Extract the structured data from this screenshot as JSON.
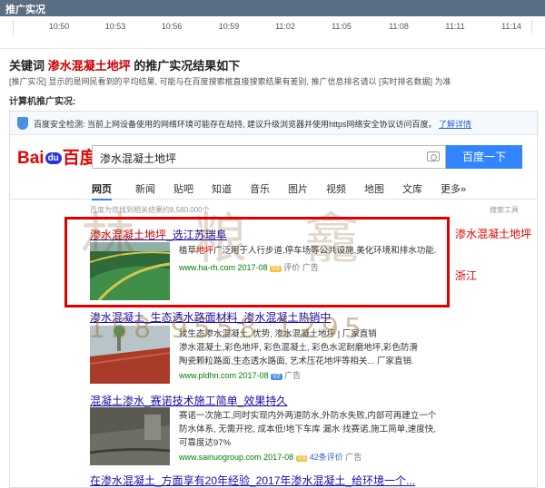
{
  "panel": {
    "title": "推广实况"
  },
  "timeline": {
    "ticks": [
      "10:50",
      "10:53",
      "10:56",
      "10:59",
      "11:02",
      "11:05",
      "11:08",
      "11:11",
      "11:14"
    ]
  },
  "headline": {
    "prefix": "关键词",
    "keyword": "渗水混凝土地坪",
    "suffix": "的推广实况结果如下"
  },
  "subnote": "[推广实况] 显示的是网民看到的平均结果, 可能与在百度搜索框直接搜索结果有差别, 推广信息排名请以 [实时排名数据] 为准",
  "section_title": "计算机推广实况:",
  "safety": {
    "text": "百度安全检测: 当前上网设备使用的网络环境可能存在劫持, 建议升级浏览器并使用https网络安全协议访问百度。",
    "link": "了解详情"
  },
  "search": {
    "logo_left": "Bai",
    "logo_mid": "du",
    "logo_right": "百度",
    "query": "渗水混凝土地坪",
    "button": "百度一下"
  },
  "tabs": [
    "网页",
    "新闻",
    "贴吧",
    "知道",
    "音乐",
    "图片",
    "视频",
    "地图",
    "文库",
    "更多»"
  ],
  "result_count": "百度为您找到相关结果约8,580,000个",
  "tools": "搜索工具",
  "results": [
    {
      "title_kw": "渗水混凝土地坪",
      "title_rest": "_选江苏瑞阜",
      "desc_pre": "植草",
      "desc_kw": "地坪",
      "desc_post": "广泛用于人行步道,停车场等公共设施,美化环境和排水功能.",
      "url": "www.ha-rh.com",
      "date": "2017-08",
      "badge": "V3",
      "eval": "评价",
      "ad": "广告"
    },
    {
      "title": "渗水混凝土_生态透水路面材料_渗水混凝土热销中",
      "desc_l1": "找生态渗水混凝土, 优势, 渗水混凝土地坪 | 厂家直销",
      "desc_l2": "渗水混凝土,彩色地坪, 彩色混凝土, 彩色水泥耐磨地坪,彩色防滑",
      "desc_l3": "陶瓷颗粒路面,生态透水路面, 艺术压花地坪等相关... 厂家直销.",
      "url": "www.pldhn.com",
      "date": "2017-08",
      "badge": "V2",
      "ad": "广告"
    },
    {
      "title": "混凝土渗水_赛诺技术施工简单_效果持久",
      "desc_l1": "赛诺一次施工,同时实现内外两道防水,外防水失败,内部可再建立一个",
      "desc_l2": "防水体系, 无需开挖, 成本低!地下车库 漏水 找赛诺,施工简单,速度快,",
      "desc_l3": "可靠度达97%",
      "url": "www.sainuogroup.com",
      "date": "2017-08",
      "badge": "V3",
      "reviews": "42条评价",
      "ad": "广告"
    },
    {
      "title": "在渗水混凝土_方面享有20年经验_2017年渗水混凝土_给环境一个..."
    }
  ],
  "annotation": {
    "keyword": "渗水混凝土地坪",
    "region": "浙江"
  },
  "watermark": {
    "text": "林 粮 龕",
    "phone": "158 9558 1295"
  }
}
